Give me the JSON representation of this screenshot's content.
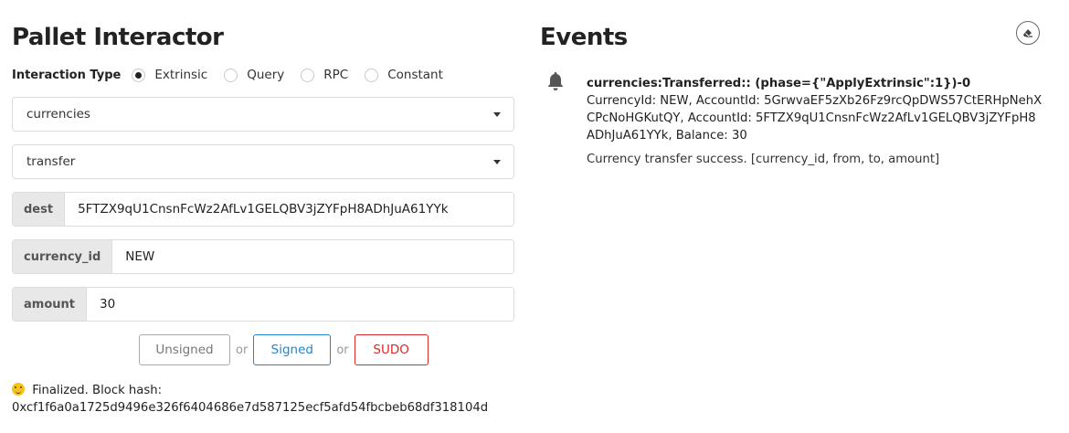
{
  "interactor": {
    "title": "Pallet Interactor",
    "interaction_type_label": "Interaction Type",
    "radio_options": [
      "Extrinsic",
      "Query",
      "RPC",
      "Constant"
    ],
    "selected_option": "Extrinsic",
    "pallet_value": "currencies",
    "callable_value": "transfer",
    "fields": [
      {
        "label": "dest",
        "value": "5FTZX9qU1CnsnFcWz2AfLv1GELQBV3jZYFpH8ADhJuA61YYk"
      },
      {
        "label": "currency_id",
        "value": "NEW"
      },
      {
        "label": "amount",
        "value": "30"
      }
    ],
    "buttons": {
      "unsigned": "Unsigned",
      "signed": "Signed",
      "sudo": "SUDO",
      "or": "or"
    },
    "status": {
      "line1": "Finalized. Block hash:",
      "line2": "0xcf1f6a0a1725d9496e326f6404686e7d587125ecf5afd54fbcbeb68df318104d"
    }
  },
  "events": {
    "title": "Events",
    "items": [
      {
        "title": "currencies:Transferred:: (phase={\"ApplyExtrinsic\":1})-0",
        "data": "CurrencyId: NEW, AccountId: 5GrwvaEF5zXb26Fz9rcQpDWS57CtERHpNehXCPcNoHGKutQY, AccountId: 5FTZX9qU1CnsnFcWz2AfLv1GELQBV3jZYFpH8ADhJuA61YYk, Balance: 30",
        "description": "Currency transfer success. [currency_id, from, to, amount]"
      }
    ]
  },
  "colors": {
    "signed": "#2185d0",
    "sudo": "#db2828",
    "unsigned": "#aaaaaa"
  },
  "icons": [
    "bell-icon",
    "eraser-icon",
    "smile-emoji-icon",
    "caret-down-icon"
  ]
}
